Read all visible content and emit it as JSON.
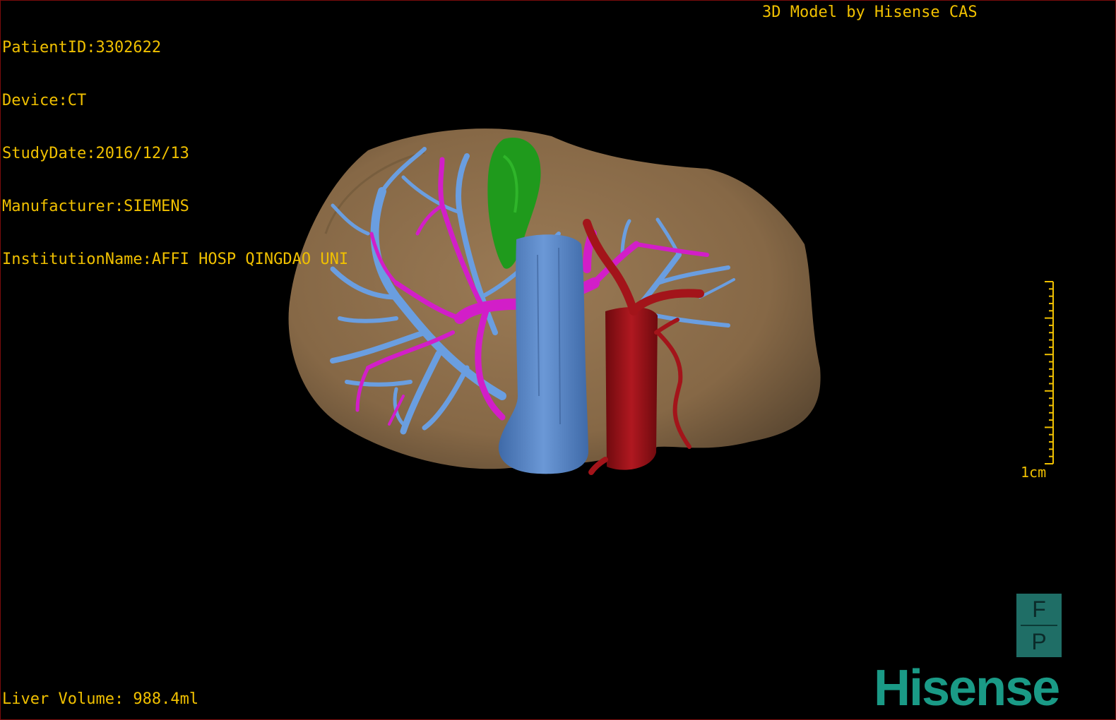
{
  "colors": {
    "text": "#f0c000",
    "brand": "#1a9a86",
    "liver": "#8a6b4a",
    "hepatic_vein": "#6a9ee0",
    "portal_vein": "#d21ec8",
    "artery": "#a3141a",
    "gallbladder": "#1f9a1c",
    "ivc": "#5a86c8"
  },
  "dicom": {
    "patient_id": "PatientID:3302622",
    "device": "Device:CT",
    "study_date": "StudyDate:2016/12/13",
    "manufacturer": "Manufacturer:SIEMENS",
    "institution": "InstitutionName:AFFI HOSP QINGDAO UNI"
  },
  "credit": "3D Model by Hisense CAS",
  "liver_volume": "Liver Volume: 988.4ml",
  "scale_label": "1cm",
  "orientation": {
    "top": "F",
    "bottom": "P"
  },
  "brand": "Hisense"
}
